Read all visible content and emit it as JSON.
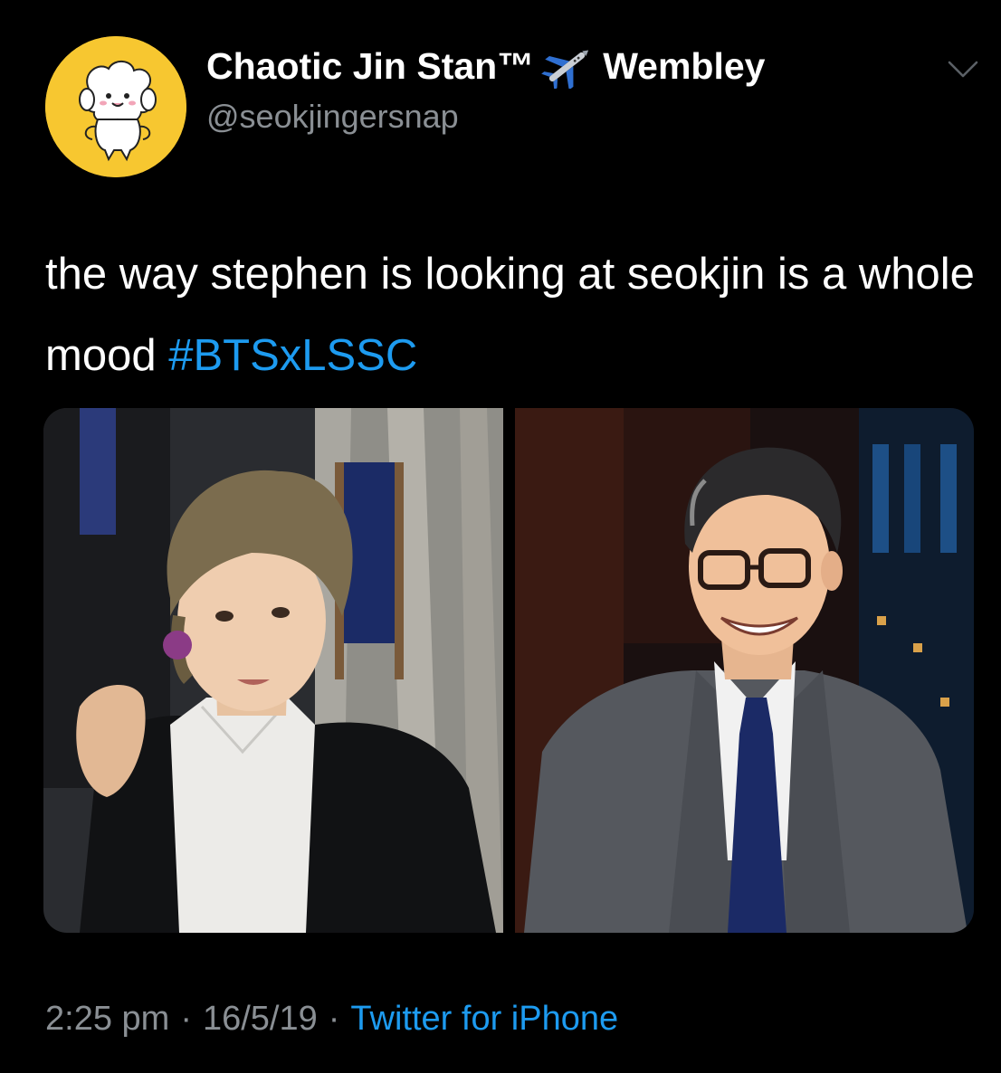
{
  "tweet": {
    "display_name": "Chaotic Jin Stan™",
    "location": "Wembley",
    "handle": "@seokjingersnap",
    "text": "the way stephen is looking at seokjin is a whole mood",
    "hashtag": "#BTSxLSSC",
    "time": "2:25 pm",
    "date": "16/5/19",
    "source": "Twitter for iPhone",
    "separator": "·"
  },
  "icons": {
    "avatar": "sheep-cartoon-avatar",
    "airplane": "airplane-icon",
    "menu": "chevron-down-icon"
  },
  "colors": {
    "background": "#000000",
    "text": "#ffffff",
    "muted": "#8a8f94",
    "link": "#1d9bf0",
    "avatar_bg": "#f7c730"
  }
}
